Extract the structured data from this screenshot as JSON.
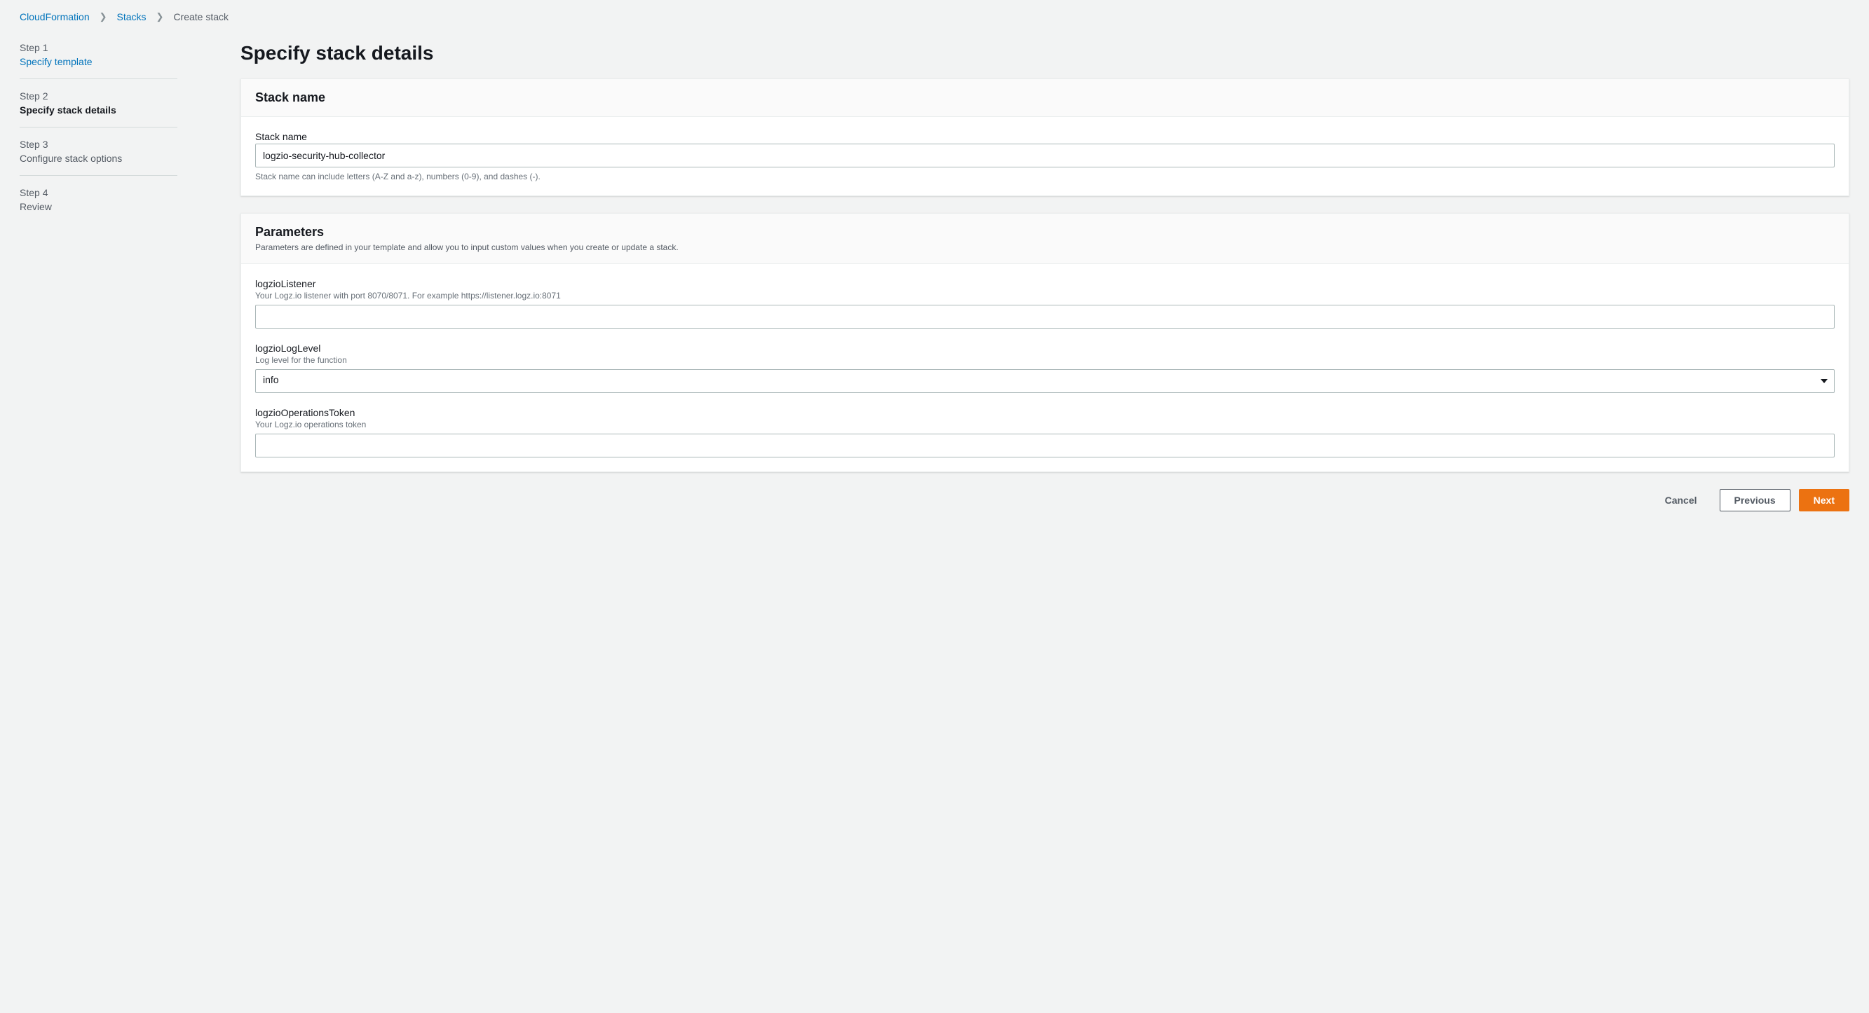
{
  "breadcrumb": {
    "root": "CloudFormation",
    "stacks": "Stacks",
    "current": "Create stack"
  },
  "sidebar": {
    "steps": [
      {
        "num": "Step 1",
        "label": "Specify template",
        "state": "link"
      },
      {
        "num": "Step 2",
        "label": "Specify stack details",
        "state": "active"
      },
      {
        "num": "Step 3",
        "label": "Configure stack options",
        "state": "future"
      },
      {
        "num": "Step 4",
        "label": "Review",
        "state": "future"
      }
    ]
  },
  "page_title": "Specify stack details",
  "stack_name_panel": {
    "heading": "Stack name",
    "label": "Stack name",
    "value": "logzio-security-hub-collector",
    "hint": "Stack name can include letters (A-Z and a-z), numbers (0-9), and dashes (-)."
  },
  "parameters_panel": {
    "heading": "Parameters",
    "desc": "Parameters are defined in your template and allow you to input custom values when you create or update a stack.",
    "fields": {
      "logzioListener": {
        "label": "logzioListener",
        "desc": "Your Logz.io listener with port 8070/8071. For example https://listener.logz.io:8071",
        "value": ""
      },
      "logzioLogLevel": {
        "label": "logzioLogLevel",
        "desc": "Log level for the function",
        "value": "info"
      },
      "logzioOperationsToken": {
        "label": "logzioOperationsToken",
        "desc": "Your Logz.io operations token",
        "value": ""
      }
    }
  },
  "actions": {
    "cancel": "Cancel",
    "previous": "Previous",
    "next": "Next"
  }
}
